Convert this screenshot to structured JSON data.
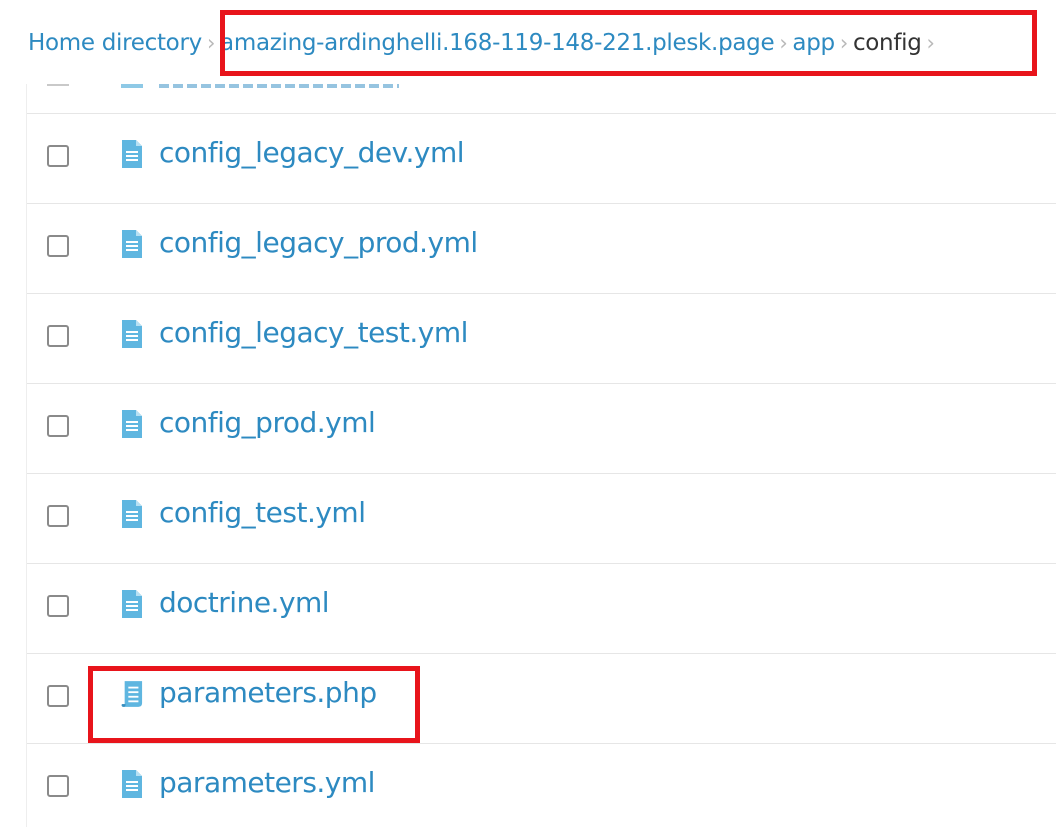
{
  "breadcrumb": {
    "items": [
      {
        "label": "Home directory"
      },
      {
        "label": "amazing-ardinghelli.168-119-148-221.plesk.page"
      },
      {
        "label": "app"
      },
      {
        "label": "config"
      }
    ],
    "separator": "›"
  },
  "files": [
    {
      "name": "config_legacy_dev.yml",
      "icon": "document-icon"
    },
    {
      "name": "config_legacy_prod.yml",
      "icon": "document-icon"
    },
    {
      "name": "config_legacy_test.yml",
      "icon": "document-icon"
    },
    {
      "name": "config_prod.yml",
      "icon": "document-icon"
    },
    {
      "name": "config_test.yml",
      "icon": "document-icon"
    },
    {
      "name": "doctrine.yml",
      "icon": "document-icon"
    },
    {
      "name": "parameters.php",
      "icon": "script-icon"
    },
    {
      "name": "parameters.yml",
      "icon": "document-icon"
    }
  ],
  "colors": {
    "link": "#2d8ac1",
    "highlight": "#e8141b",
    "icon": "#5fb6e0"
  }
}
